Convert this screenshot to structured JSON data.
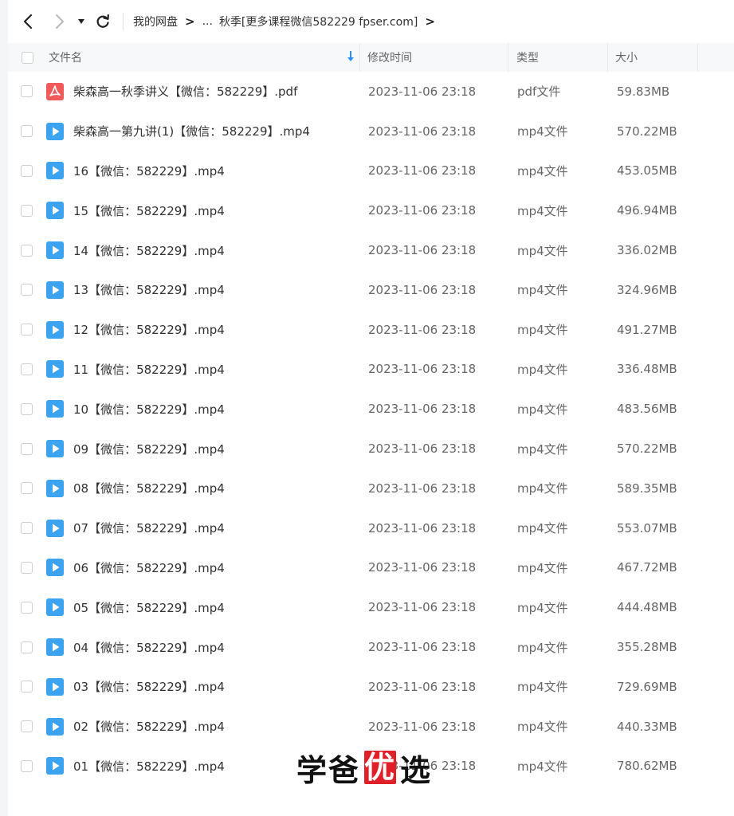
{
  "breadcrumb": {
    "root": "我的网盘",
    "ellipsis": "...",
    "current": "秋季[更多课程微信582229 fpser.com]"
  },
  "columns": {
    "name": "文件名",
    "modified": "修改时间",
    "type": "类型",
    "size": "大小"
  },
  "files": [
    {
      "name": "柴森高一秋季讲义【微信：582229】.pdf",
      "modified": "2023-11-06 23:18",
      "type": "pdf文件",
      "size": "59.83MB",
      "icon": "pdf-file-icon"
    },
    {
      "name": "柴森高一第九讲(1)【微信：582229】.mp4",
      "modified": "2023-11-06 23:18",
      "type": "mp4文件",
      "size": "570.22MB",
      "icon": "video-file-icon"
    },
    {
      "name": "16【微信：582229】.mp4",
      "modified": "2023-11-06 23:18",
      "type": "mp4文件",
      "size": "453.05MB",
      "icon": "video-file-icon"
    },
    {
      "name": "15【微信：582229】.mp4",
      "modified": "2023-11-06 23:18",
      "type": "mp4文件",
      "size": "496.94MB",
      "icon": "video-file-icon"
    },
    {
      "name": "14【微信：582229】.mp4",
      "modified": "2023-11-06 23:18",
      "type": "mp4文件",
      "size": "336.02MB",
      "icon": "video-file-icon"
    },
    {
      "name": "13【微信：582229】.mp4",
      "modified": "2023-11-06 23:18",
      "type": "mp4文件",
      "size": "324.96MB",
      "icon": "video-file-icon"
    },
    {
      "name": "12【微信：582229】.mp4",
      "modified": "2023-11-06 23:18",
      "type": "mp4文件",
      "size": "491.27MB",
      "icon": "video-file-icon"
    },
    {
      "name": "11【微信：582229】.mp4",
      "modified": "2023-11-06 23:18",
      "type": "mp4文件",
      "size": "336.48MB",
      "icon": "video-file-icon"
    },
    {
      "name": "10【微信：582229】.mp4",
      "modified": "2023-11-06 23:18",
      "type": "mp4文件",
      "size": "483.56MB",
      "icon": "video-file-icon"
    },
    {
      "name": "09【微信：582229】.mp4",
      "modified": "2023-11-06 23:18",
      "type": "mp4文件",
      "size": "570.22MB",
      "icon": "video-file-icon"
    },
    {
      "name": "08【微信：582229】.mp4",
      "modified": "2023-11-06 23:18",
      "type": "mp4文件",
      "size": "589.35MB",
      "icon": "video-file-icon"
    },
    {
      "name": "07【微信：582229】.mp4",
      "modified": "2023-11-06 23:18",
      "type": "mp4文件",
      "size": "553.07MB",
      "icon": "video-file-icon"
    },
    {
      "name": "06【微信：582229】.mp4",
      "modified": "2023-11-06 23:18",
      "type": "mp4文件",
      "size": "467.72MB",
      "icon": "video-file-icon"
    },
    {
      "name": "05【微信：582229】.mp4",
      "modified": "2023-11-06 23:18",
      "type": "mp4文件",
      "size": "444.48MB",
      "icon": "video-file-icon"
    },
    {
      "name": "04【微信：582229】.mp4",
      "modified": "2023-11-06 23:18",
      "type": "mp4文件",
      "size": "355.28MB",
      "icon": "video-file-icon"
    },
    {
      "name": "03【微信：582229】.mp4",
      "modified": "2023-11-06 23:18",
      "type": "mp4文件",
      "size": "729.69MB",
      "icon": "video-file-icon"
    },
    {
      "name": "02【微信：582229】.mp4",
      "modified": "2023-11-06 23:18",
      "type": "mp4文件",
      "size": "440.33MB",
      "icon": "video-file-icon"
    },
    {
      "name": "01【微信：582229】.mp4",
      "modified": "2023-11-06 23:18",
      "type": "mp4文件",
      "size": "780.62MB",
      "icon": "video-file-icon"
    }
  ],
  "watermark": {
    "text1": "学爸",
    "boxed": "优",
    "text2": "选"
  },
  "colors": {
    "video_icon": "#3ba3f0",
    "pdf_icon": "#f05a5a",
    "header_bg": "#f7f8fa",
    "sort_arrow": "#2b8ff5",
    "watermark_box": "#e02028"
  }
}
